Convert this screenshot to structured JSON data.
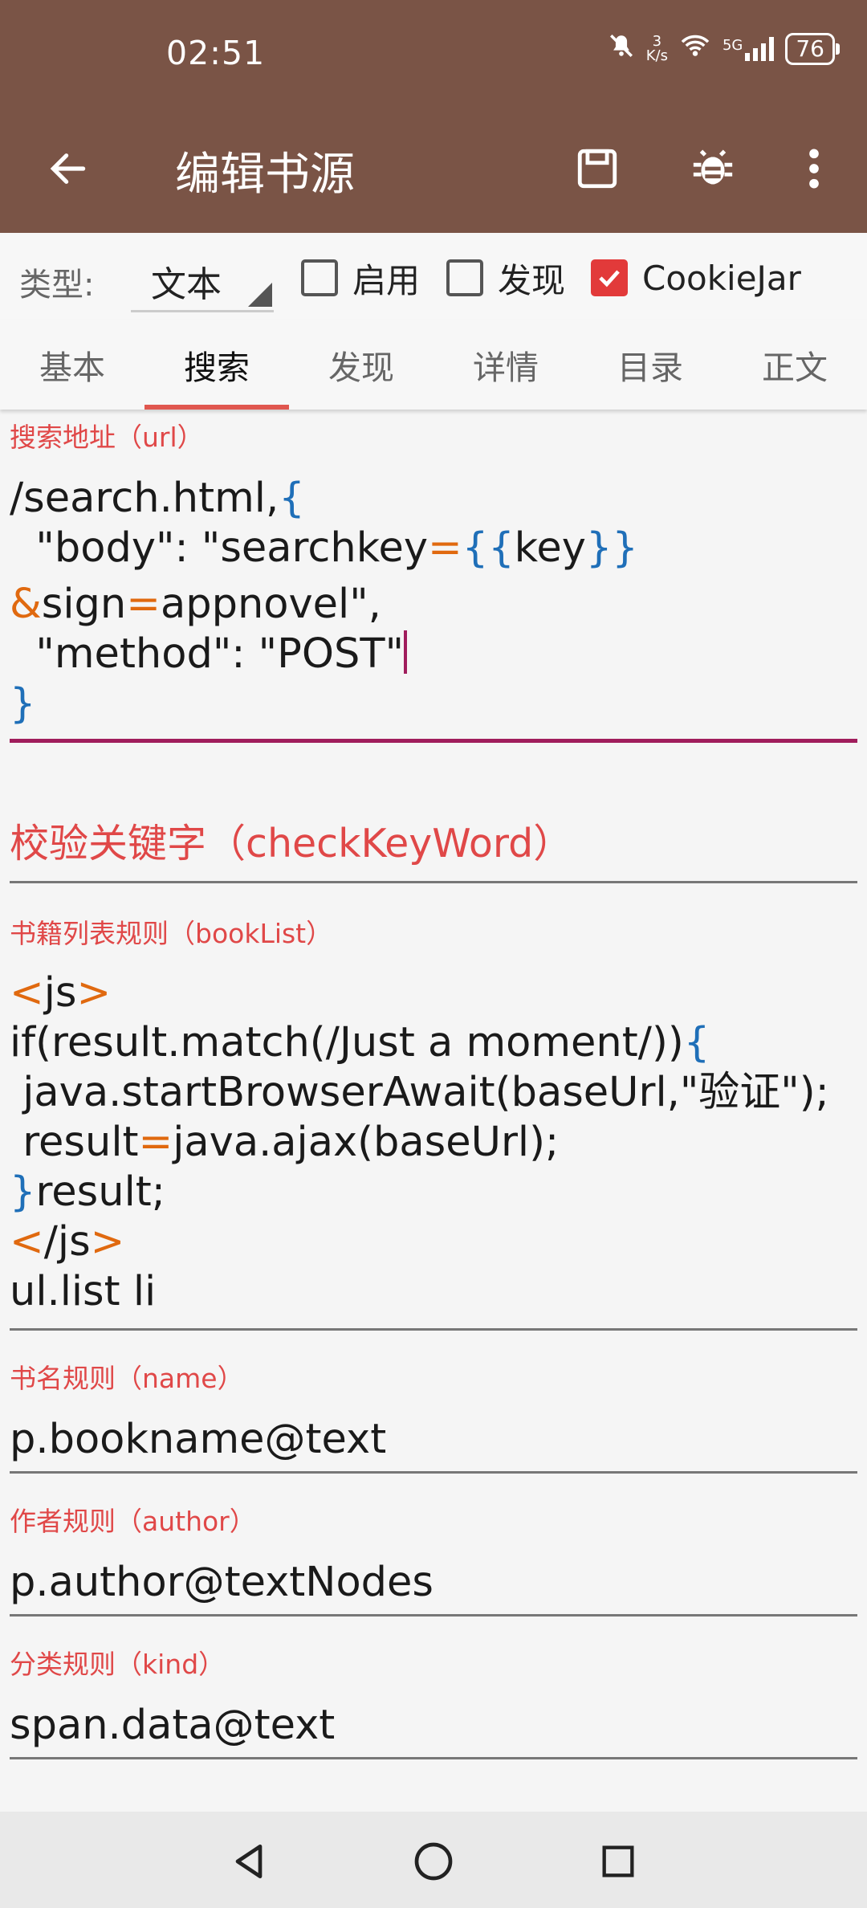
{
  "status": {
    "time": "02:51",
    "speed_value": "3",
    "speed_unit": "K/s",
    "network_label": "5G",
    "battery": "76"
  },
  "appbar": {
    "title": "编辑书源",
    "icons": [
      "back-arrow-icon",
      "save-icon",
      "debug-bug-icon",
      "more-vert-icon"
    ]
  },
  "typebar": {
    "type_label": "类型:",
    "type_value": "文本",
    "checkboxes": [
      {
        "label": "启用",
        "checked": false
      },
      {
        "label": "发现",
        "checked": false
      },
      {
        "label": "CookieJar",
        "checked": true
      }
    ]
  },
  "tabs": [
    {
      "label": "基本",
      "active": false
    },
    {
      "label": "搜索",
      "active": true
    },
    {
      "label": "发现",
      "active": false
    },
    {
      "label": "详情",
      "active": false
    },
    {
      "label": "目录",
      "active": false
    },
    {
      "label": "正文",
      "active": false
    }
  ],
  "fields": {
    "search_url": {
      "label": "搜索地址（url）",
      "lines": [
        "/search.html,{",
        "  \"body\": \"searchkey={{key}}",
        "&sign=appnovel\",",
        "  \"method\": \"POST\"",
        "}"
      ]
    },
    "check_keyword": {
      "placeholder": "校验关键字（checkKeyWord）"
    },
    "book_list": {
      "label": "书籍列表规则（bookList）",
      "lines": [
        "<js>",
        "if(result.match(/Just a moment/)){",
        " java.startBrowserAwait(baseUrl,\"验证\");",
        " result=java.ajax(baseUrl);",
        "}result;",
        "</js>",
        "ul.list li"
      ]
    },
    "name": {
      "label": "书名规则（name）",
      "value": "p.bookname@text"
    },
    "author": {
      "label": "作者规则（author）",
      "value": "p.author@textNodes"
    },
    "kind": {
      "label": "分类规则（kind）",
      "value": "span.data@text"
    }
  },
  "colors": {
    "appbar": "#7a5446",
    "accent": "#e0574f",
    "label_red": "#e04848",
    "keyword_blue": "#1f6fb8",
    "operator_orange": "#e0690f"
  }
}
